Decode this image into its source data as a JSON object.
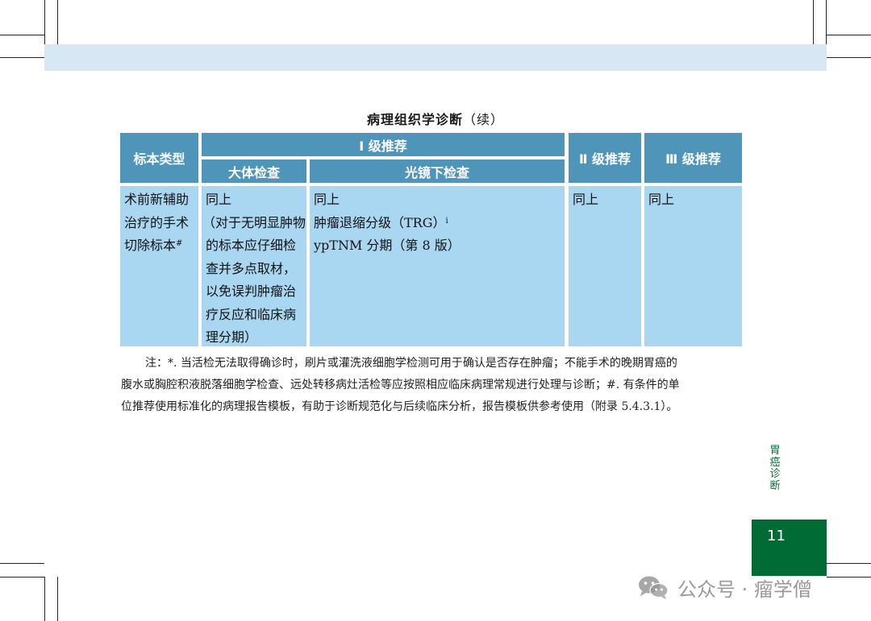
{
  "header_band": {
    "color": "#d7e8f4"
  },
  "table_title": {
    "main": "病理组织学诊断",
    "suffix": "（续）"
  },
  "table": {
    "header": {
      "specimen_type": "标本类型",
      "level1": "Ⅰ 级推荐",
      "level1_gross": "大体检查",
      "level1_micro": "光镜下检查",
      "level2": "Ⅱ 级推荐",
      "level3": "Ⅲ 级推荐"
    },
    "row": {
      "specimen_lines": [
        "术前新辅助",
        "治疗的手术",
        "切除标本"
      ],
      "specimen_mark": "#",
      "gross_lines": [
        "同上",
        "（对于无明显肿物",
        "的标本应仔细检",
        "查并多点取材，",
        "以免误判肿瘤治",
        "疗反应和临床病",
        "理分期）"
      ],
      "micro_line1": "同上",
      "micro_line2": "肿瘤退缩分级（TRG）",
      "micro_line2_mark": "i",
      "micro_line3": "ypTNM 分期（第 8 版）",
      "level2": "同上",
      "level3": "同上"
    },
    "colors": {
      "header_bg": "#4f95b9",
      "body_bg": "#a9d7f1"
    }
  },
  "note": {
    "lines": [
      "注：*. 当活检无法取得确诊时，刷片或灌洗液细胞学检测可用于确认是否存在肿瘤；不能手术的晚期胃癌的",
      "腹水或胸腔积液脱落细胞学检查、远处转移病灶活检等应按照相应临床病理常规进行处理与诊断；#. 有条件的单",
      "位推荐使用标准化的病理报告模板，有助于诊断规范化与后续临床分析，报告模板供参考使用（附录 5.4.3.1）。"
    ]
  },
  "side_tab": {
    "chars": [
      "胃",
      "癌",
      "诊",
      "断"
    ],
    "color": "#0d6b3a"
  },
  "page_number": "11",
  "page_box_color": "#006b35",
  "watermark": {
    "icon": "wechat-icon",
    "text": "公众号 · 瘤学僧"
  }
}
